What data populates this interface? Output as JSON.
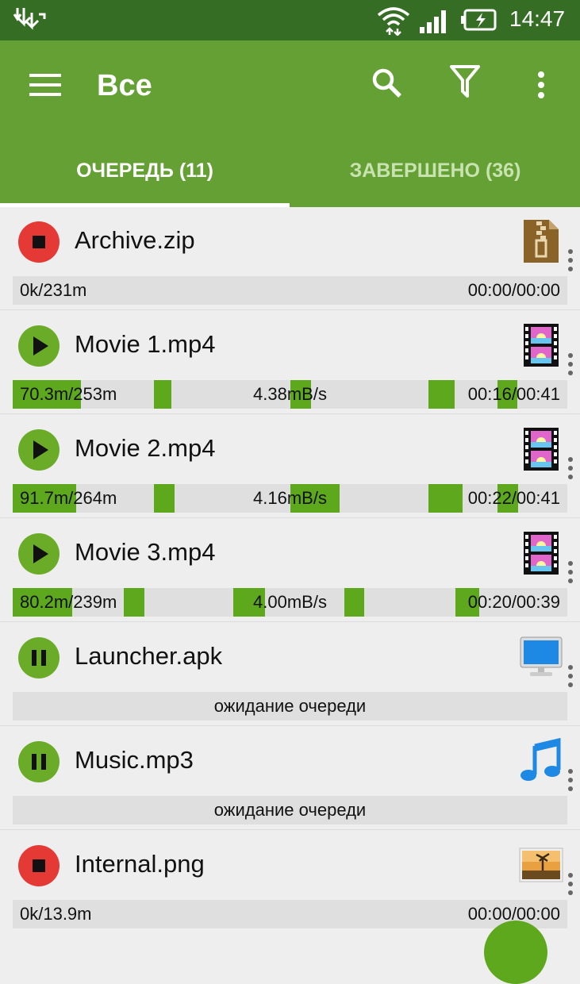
{
  "status_bar": {
    "time": "14:47"
  },
  "app_bar": {
    "title": "Все"
  },
  "tabs": [
    {
      "label": "ОЧЕРЕДЬ (11)"
    },
    {
      "label": "ЗАВЕРШЕНО (36)"
    }
  ],
  "downloads": [
    {
      "name": "Archive.zip",
      "state": "stopped",
      "type_icon": "zip-archive-icon",
      "left": "0k/231m",
      "right": "00:00/00:00"
    },
    {
      "name": "Movie 1.mp4",
      "state": "paused",
      "type_icon": "video-film-icon",
      "left": "70.3m/253m",
      "center": "4.38mB/s",
      "right": "00:16/00:41"
    },
    {
      "name": "Movie 2.mp4",
      "state": "paused",
      "type_icon": "video-film-icon",
      "left": "91.7m/264m",
      "center": "4.16mB/s",
      "right": "00:22/00:41"
    },
    {
      "name": "Movie 3.mp4",
      "state": "paused",
      "type_icon": "video-film-icon",
      "left": "80.2m/239m",
      "center": "4.00mB/s",
      "right": "00:20/00:39"
    },
    {
      "name": "Launcher.apk",
      "state": "queued",
      "type_icon": "monitor-icon",
      "center": "ожидание очереди"
    },
    {
      "name": "Music.mp3",
      "state": "queued",
      "type_icon": "music-note-icon",
      "center": "ожидание очереди"
    },
    {
      "name": "Internal.png",
      "state": "stopped",
      "type_icon": "image-icon",
      "left": "0k/13.9m",
      "right": "00:00/00:00"
    }
  ],
  "colors": {
    "status_bar": "#366d24",
    "app_bar": "#64a033",
    "progress": "#5ea81e",
    "stop": "#e53935"
  }
}
